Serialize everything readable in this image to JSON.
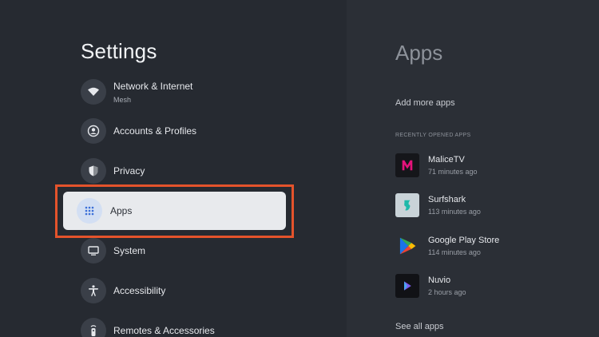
{
  "settings": {
    "title": "Settings",
    "items": [
      {
        "label": "Network & Internet",
        "sub": "Mesh",
        "icon": "wifi-icon"
      },
      {
        "label": "Accounts & Profiles",
        "icon": "account-icon"
      },
      {
        "label": "Privacy",
        "icon": "shield-icon"
      },
      {
        "label": "Apps",
        "icon": "apps-grid-icon",
        "selected": true
      },
      {
        "label": "System",
        "icon": "monitor-icon"
      },
      {
        "label": "Accessibility",
        "icon": "accessibility-icon"
      },
      {
        "label": "Remotes & Accessories",
        "icon": "remote-icon"
      }
    ]
  },
  "apps_panel": {
    "title": "Apps",
    "add_more": "Add more apps",
    "recent_header": "RECENTLY OPENED APPS",
    "recent": [
      {
        "name": "MaliceTV",
        "time": "71 minutes ago",
        "icon": "malicetv-icon"
      },
      {
        "name": "Surfshark",
        "time": "113 minutes ago",
        "icon": "surfshark-icon"
      },
      {
        "name": "Google Play Store",
        "time": "114 minutes ago",
        "icon": "play-store-icon"
      },
      {
        "name": "Nuvio",
        "time": "2 hours ago",
        "icon": "nuvio-icon"
      }
    ],
    "see_all": "See all apps"
  },
  "colors": {
    "background": "#262a31",
    "right_panel": "#2b2f36",
    "highlight_frame": "#e4532b",
    "selected_card": "#e8eaed"
  }
}
